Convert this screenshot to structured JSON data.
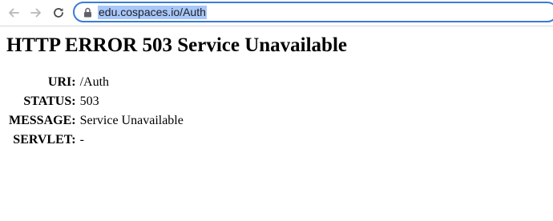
{
  "browser": {
    "back_icon": "arrow-left-icon",
    "forward_icon": "arrow-right-icon",
    "reload_icon": "reload-icon",
    "lock_icon": "lock-icon",
    "url": "edu.cospaces.io/Auth",
    "accent_color": "#3a7bd5",
    "selection_color": "#a8c7fa"
  },
  "page": {
    "title": "HTTP ERROR 503 Service Unavailable",
    "rows": [
      {
        "label": "URI:",
        "value": "/Auth"
      },
      {
        "label": "STATUS:",
        "value": "503"
      },
      {
        "label": "MESSAGE:",
        "value": "Service Unavailable"
      },
      {
        "label": "SERVLET:",
        "value": "-"
      }
    ]
  }
}
